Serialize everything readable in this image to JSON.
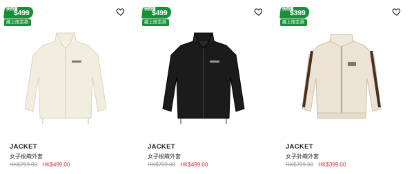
{
  "products": [
    {
      "badge": {
        "top": "快閃價",
        "price": "$499",
        "sub": "線上限定款"
      },
      "name": "JACKET",
      "desc": "女子梭織外套",
      "old_price": "HK$799.00",
      "new_price": "HK$499.00"
    },
    {
      "badge": {
        "top": "快閃價",
        "price": "$499",
        "sub": "線上限定款"
      },
      "name": "JACKET",
      "desc": "女子梭織外套",
      "old_price": "HK$799.00",
      "new_price": "HK$499.00"
    },
    {
      "badge": {
        "top": "快閃價",
        "price": "$399",
        "sub": "線上限定款"
      },
      "name": "JACKET",
      "desc": "女子針織外套",
      "old_price": "HK$799.00",
      "new_price": "HK$399.00"
    }
  ],
  "colors": {
    "badge": "#1a8f3a",
    "sale": "#d32f2f",
    "jacket1": "#f1eee0",
    "jacket2": "#1b1b1b",
    "jacket3": "#ece3d4",
    "stripe3": "#4a2e1e"
  },
  "icons": {
    "wishlist": "heart-outline-icon"
  }
}
